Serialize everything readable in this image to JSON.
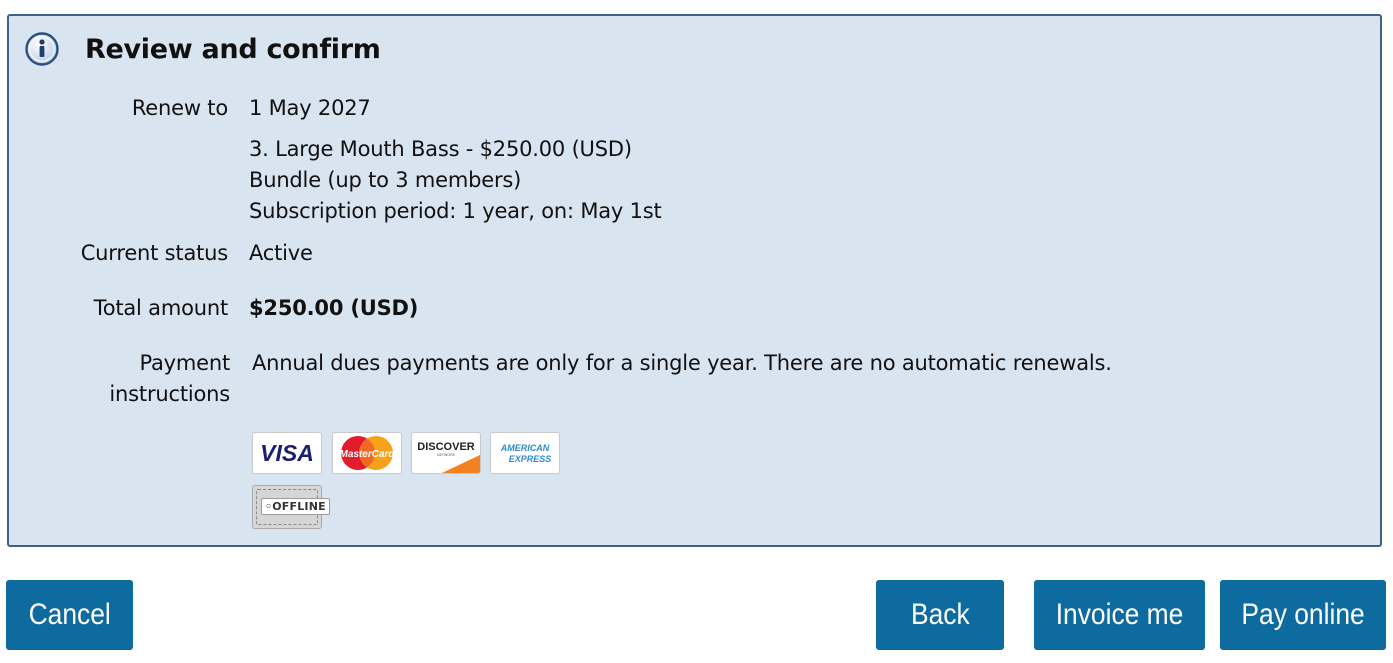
{
  "panel": {
    "title": "Review and confirm",
    "icon": "info-icon"
  },
  "details": {
    "renew_to_label": "Renew to",
    "renew_to_value": "1 May 2027",
    "level_line1": "3. Large Mouth Bass - $250.00 (USD)",
    "level_line2": "Bundle (up to 3 members)",
    "level_line3": "Subscription period: 1 year, on: May 1st",
    "status_label": "Current status",
    "status_value": "Active",
    "total_label": "Total amount",
    "total_value": "$250.00 (USD)",
    "payment_label_line1": "Payment",
    "payment_label_line2": "instructions",
    "payment_value": "Annual dues payments are only for a single year. There are no automatic renewals."
  },
  "payment_methods": {
    "visa": "VISA",
    "mastercard": "MasterCard",
    "discover": "DISCOVER",
    "discover_sub": "NETWORK",
    "amex_line1": "AMERICAN",
    "amex_line2": "EXPRESS",
    "offline": "OFFLINE"
  },
  "actions": {
    "cancel": "Cancel",
    "back": "Back",
    "invoice": "Invoice me",
    "pay_online": "Pay online"
  },
  "colors": {
    "panel_bg": "#d9e4f1",
    "panel_border": "#3f6286",
    "button_bg": "#0e6b9f"
  }
}
